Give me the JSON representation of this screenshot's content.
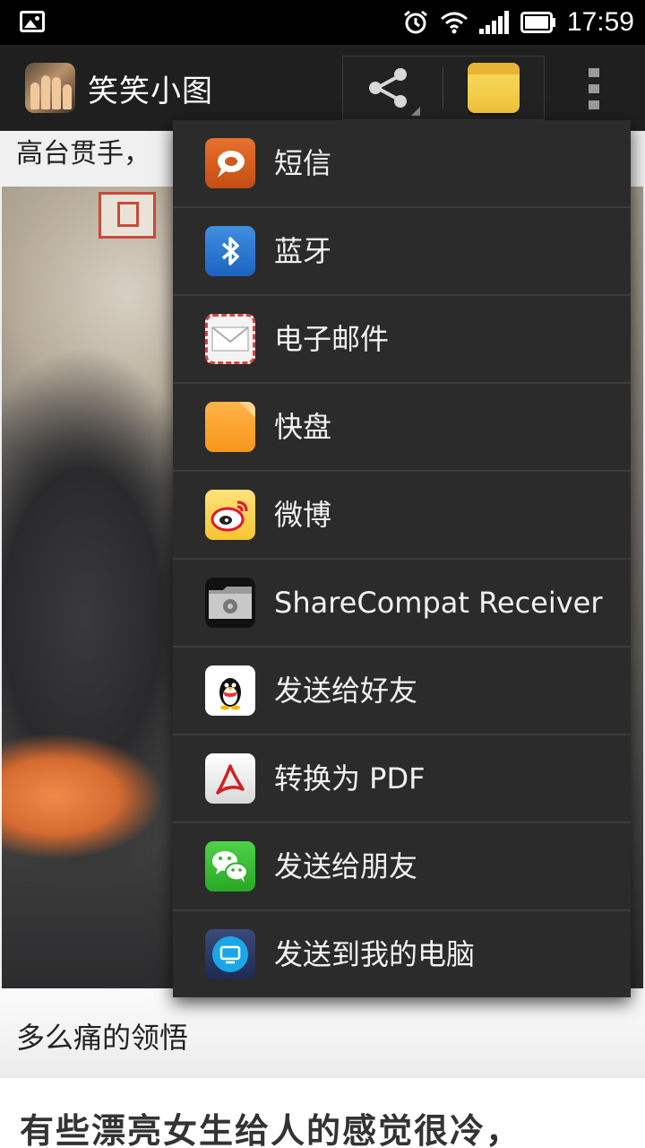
{
  "status_bar": {
    "time": "17:59",
    "icons": [
      "photo-notification-icon",
      "alarm-icon",
      "wifi-icon",
      "signal-icon",
      "battery-icon"
    ]
  },
  "action_bar": {
    "app_title": "笑笑小图",
    "app_icon": "app-logo-icon",
    "share_icon": "share-icon",
    "notes_icon": "notes-icon",
    "overflow_icon": "overflow-menu-icon"
  },
  "content": {
    "post1_text": "高台贯手，",
    "post2_caption": "多么痛的领悟",
    "post3_text": "有些漂亮女生给人的感觉很冷，"
  },
  "share_menu": {
    "items": [
      {
        "label": "短信",
        "icon": "sms-icon"
      },
      {
        "label": "蓝牙",
        "icon": "bluetooth-icon"
      },
      {
        "label": "电子邮件",
        "icon": "email-icon"
      },
      {
        "label": "快盘",
        "icon": "kuaipan-folder-icon"
      },
      {
        "label": "微博",
        "icon": "weibo-icon"
      },
      {
        "label": "ShareCompat Receiver",
        "icon": "settings-folder-icon"
      },
      {
        "label": "发送给好友",
        "icon": "qq-icon"
      },
      {
        "label": "转换为 PDF",
        "icon": "pdf-icon"
      },
      {
        "label": "发送给朋友",
        "icon": "wechat-icon"
      },
      {
        "label": "发送到我的电脑",
        "icon": "monitor-icon"
      }
    ]
  },
  "colors": {
    "menu_background": "#2b2b2b",
    "action_bar_background": "#1f1f1f",
    "status_bar_background": "#000000"
  }
}
